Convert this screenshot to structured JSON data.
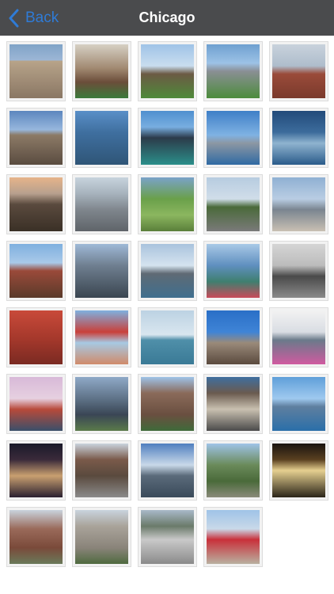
{
  "nav": {
    "back_label": "Back",
    "title": "Chicago"
  },
  "colors": {
    "navbar": "#4a4b4d",
    "accent": "#2f7bd6",
    "title": "#ffffff"
  },
  "photos": [
    {
      "name": "photo-wrigley-building",
      "bg": "linear-gradient(#7fa3c7 0%,#9db7d6 30%,#b8a48a 30%,#8a7764 100%)"
    },
    {
      "name": "photo-bull-statue",
      "bg": "linear-gradient(#d6d0c4 0%,#a08870 45%,#6b4d3a 70%,#3b7a3b 100%)"
    },
    {
      "name": "photo-park-field",
      "bg": "linear-gradient(#9fc3e7 0%,#c9ddef 40%,#6b5a44 55%,#4f8a3a 100%)"
    },
    {
      "name": "photo-stadium-lawn",
      "bg": "linear-gradient(#6ea0d0 0%,#9dc2e6 35%,#8a8f94 50%,#4c8c3c 100%)"
    },
    {
      "name": "photo-clock-tower",
      "bg": "linear-gradient(#c9d2dc 0%,#aebdcc 40%,#9a4b3a 55%,#7a3a2c 100%)"
    },
    {
      "name": "photo-tall-tower-sky",
      "bg": "linear-gradient(#5c86be 0%,#97b7dd 35%,#8c7a66 45%,#5a4c40 100%)"
    },
    {
      "name": "photo-glass-tower",
      "bg": "linear-gradient(#5a8fc8 0%,#3f6f9f 40%,#2f5577 100%)"
    },
    {
      "name": "photo-dark-skyscraper",
      "bg": "linear-gradient(#4f8fcf 0%,#78aee0 30%,#2c3b4a 50%,#2b8f8a 100%)"
    },
    {
      "name": "photo-skyline-lake",
      "bg": "linear-gradient(#3f7fc7 0%,#7fb2e3 45%,#8c97a3 60%,#2f6aa3 100%)"
    },
    {
      "name": "photo-navy-pier-aerial",
      "bg": "linear-gradient(#214a7a 0%,#3d6c9c 40%,#8fb3cf 60%,#2a5b8a 100%)"
    },
    {
      "name": "photo-bronze-tower-sunset",
      "bg": "linear-gradient(#e6b48a 0%,#b7a08e 30%,#5a4a3e 50%,#3a3026 100%)"
    },
    {
      "name": "photo-city-aerial",
      "bg": "linear-gradient(#c7d3dd 0%,#a7b3bd 30%,#7f868d 60%,#5f6469 100%)"
    },
    {
      "name": "photo-park-garden",
      "bg": "linear-gradient(#7aa2c9 0%,#6aa04a 40%,#8bb65f 70%,#5a7f3a 100%)"
    },
    {
      "name": "photo-boulevard",
      "bg": "linear-gradient(#b7cce0 0%,#d0dde9 40%,#4a6a3a 55%,#7a7a7a 100%)"
    },
    {
      "name": "photo-skyline-crowd",
      "bg": "linear-gradient(#8fb0d3 0%,#b9cde3 40%,#7a8590 60%,#c9c0b3 100%)"
    },
    {
      "name": "photo-church",
      "bg": "linear-gradient(#7fb0df 0%,#a9c9e9 35%,#9a4a3a 50%,#5a3a2a 100%)"
    },
    {
      "name": "photo-towers-pair",
      "bg": "linear-gradient(#9fb9d7 0%,#6f7f90 40%,#3a4550 100%)"
    },
    {
      "name": "photo-skyline-river",
      "bg": "linear-gradient(#a9c3dd 0%,#d5e3ef 40%,#5f6a74 55%,#3f6f8f 100%)"
    },
    {
      "name": "photo-wavy-tower",
      "bg": "linear-gradient(#a9c9e7 0%,#5f8fbf 40%,#3f7f6f 70%,#c94a5a 100%)"
    },
    {
      "name": "photo-horse-statue",
      "bg": "linear-gradient(#d5d5d5 0%,#bcbcbc 40%,#4a4a4a 60%,#8a8a8a 100%)"
    },
    {
      "name": "photo-red-building",
      "bg": "linear-gradient(#c94a3a 0%,#a7392c 50%,#7a2a22 100%)"
    },
    {
      "name": "photo-ferris-wheel",
      "bg": "linear-gradient(#7fb0df 0%,#c9403a 40%,#a7c9e3 60%,#d08a6a 100%)"
    },
    {
      "name": "photo-sailboat-lake",
      "bg": "linear-gradient(#bcd2e3 0%,#d9e6ef 45%,#4f8fa9 55%,#3a7a96 100%)"
    },
    {
      "name": "photo-smokestack",
      "bg": "linear-gradient(#2a6fc7 0%,#3f84d6 40%,#9a8a7a 60%,#5a4a3e 100%)"
    },
    {
      "name": "photo-flowers-skyline",
      "bg": "linear-gradient(#f2f2f2 0%,#d9dde3 40%,#6a7a8a 55%,#d05aa0 100%)"
    },
    {
      "name": "photo-lighthouse",
      "bg": "linear-gradient(#d8b9d8 0%,#e6d0e0 40%,#b84a3a 60%,#3a4f6a 100%)"
    },
    {
      "name": "photo-skyline-park",
      "bg": "linear-gradient(#8fa9c7 0%,#5f7388 40%,#3a4655 70%,#5a7a4a 100%)"
    },
    {
      "name": "photo-apartment-tower",
      "bg": "linear-gradient(#9fc3e7 0%,#8a6a5a 30%,#6a4f40 70%,#3f6a3a 100%)"
    },
    {
      "name": "photo-corner-building",
      "bg": "linear-gradient(#3f6f9f 0%,#6a5a4f 30%,#c9c0b0 60%,#4a4a4a 100%)"
    },
    {
      "name": "photo-skyline-water",
      "bg": "linear-gradient(#5f9fd9 0%,#9fc9ef 40%,#5f7f9f 55%,#2a6fa9 100%)"
    },
    {
      "name": "photo-night-wrigley",
      "bg": "linear-gradient(#1a1a2a 0%,#3a2a3a 30%,#c9a070 60%,#2a2030 100%)"
    },
    {
      "name": "photo-street-brownstones",
      "bg": "linear-gradient(#c9d3dd 0%,#7a5a4a 30%,#5a4a3e 60%,#8a8a8a 100%)"
    },
    {
      "name": "photo-skyline-clouds",
      "bg": "linear-gradient(#4f7fbf 0%,#c9d9e9 40%,#5a6a7a 60%,#3a4a5a 100%)"
    },
    {
      "name": "photo-trees-towers",
      "bg": "linear-gradient(#9fc3e7 0%,#6a8a5a 40%,#4a6a3a 70%,#8a8a7a 100%)"
    },
    {
      "name": "photo-fountain-night",
      "bg": "linear-gradient(#1a1410 0%,#5a4020 30%,#e6d090 50%,#2a2418 100%)"
    },
    {
      "name": "photo-brick-church",
      "bg": "linear-gradient(#c9d3dd 0%,#9a6a5a 35%,#7a4a3a 70%,#6a7a5a 100%)"
    },
    {
      "name": "photo-highrise-block",
      "bg": "linear-gradient(#c9d3dd 0%,#a9a39a 30%,#8a847a 70%,#4f6a3f 100%)"
    },
    {
      "name": "photo-lion-statue",
      "bg": "linear-gradient(#a9b9c9 0%,#6a7a6a 30%,#c9c9c9 55%,#8a8a8a 100%)"
    },
    {
      "name": "photo-red-sculpture",
      "bg": "linear-gradient(#9fc3e7 0%,#c9d9e9 35%,#c9303a 55%,#b9b0a0 100%)"
    }
  ]
}
